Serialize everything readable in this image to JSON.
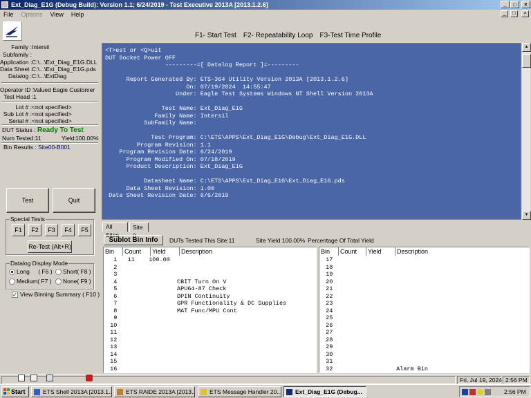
{
  "window": {
    "title": "Ext_Diag_E1G (Debug Build): Version 1.1;  6/24/2019 - Test Executive 2013A [2013.1.2.6]",
    "min_glyph": "_",
    "max_glyph": "□",
    "close_glyph": "×"
  },
  "menu": {
    "file": "File",
    "options": "Options",
    "view": "View",
    "help": "Help"
  },
  "toolbar": {
    "f1": "F1- Start Test",
    "f2": "F2- Repeatability Loop",
    "f3": "F3-Test Time Profile"
  },
  "info": {
    "family_lbl": "Family :",
    "family": "Intersil",
    "subfamily_lbl": "Subfamily :",
    "subfamily": "",
    "application_lbl": "Application :",
    "application": "C:\\...\\Ext_Diag_E1G.DLL",
    "datasheet_lbl": "Data Sheet :",
    "datasheet": "C:\\...\\Ext_Diag_E1G.pds",
    "datalog_lbl": "Datalog :",
    "datalog": "C:\\...\\ExtDiag",
    "operator_lbl": "Operator ID :",
    "operator": "Valued Eagle Customer",
    "testhead_lbl": "Test Head :",
    "testhead": "1",
    "lot_lbl": "Lot # :",
    "lot": "<not specified>",
    "sublot_lbl": "Sub Lot # :",
    "sublot": "<not specified>",
    "serial_lbl": "Serial # :",
    "serial": "<not specified>",
    "dutstatus_lbl": "DUT Status :",
    "dutstatus": "Ready To Test",
    "numtested_lbl": "Num Tested:",
    "numtested": "11",
    "yield_lbl": "Yield:",
    "yield": "100.00%",
    "binresults_lbl": "Bin Results :",
    "binresults": "Site00-B001"
  },
  "buttons": {
    "test": "Test",
    "quit": "Quit",
    "retest": "Re-Test  (Alt+R)"
  },
  "special_tests": {
    "title": "Special Tests",
    "keys": [
      "F1",
      "F2",
      "F3",
      "F4",
      "F5"
    ]
  },
  "datalog_mode": {
    "title": "Datalog Display Mode",
    "long": "Long",
    "long_key": "( F6 )",
    "short": "Short( F8 )",
    "medium": "Medium( F7 )",
    "none": "None( F9 )"
  },
  "view_binning": "View Binning Summary ( F10 )",
  "console": {
    "lines": [
      "<T>est or <Q>uit",
      "DUT Socket Power OFF",
      "                 ---------=[ Datalog Report ]=---------",
      "",
      "      Report Generated By: ETS-364 Utility Version 2013A [2013.1.2.6]",
      "                       On: 07/19/2024  14:55:47",
      "                    Under: Eagle Test Systems Windows NT Shell Version 2013A",
      "",
      "                Test Name: Ext_Diag_E1G",
      "              Family Name: Intersil",
      "           SubFamily Name:",
      "",
      "             Test Program: C:\\ETS\\APPS\\Ext_Diag_E1G\\Debug\\Ext_Diag_E1G.DLL",
      "         Program Revision: 1.1",
      "    Program Revision Date: 6/24/2019",
      "      Program Modified On: 07/18/2019",
      "      Product Description: Ext_Diag_E1G",
      "",
      "           Datasheet Name: C:\\ETS\\APPS\\Ext_Diag_E1G\\Ext_Diag_E1G.pds",
      "      Data Sheet Revision: 1.00",
      " Data Sheet Revision Date: 6/6/2019"
    ]
  },
  "tabs": [
    "All Sites",
    "Site 0"
  ],
  "bin_header": {
    "sublot": "Sublot Bin Info",
    "duts": "DUTs Tested This Site:11",
    "siteyield": "Site Yield 100.00%",
    "pct": "Percentage Of Total Yield"
  },
  "bin_columns": [
    "Bin",
    "Count",
    "Yield",
    "Description"
  ],
  "bins_left": [
    "  1   11    100.00",
    "  2",
    "  3",
    "  4                 CBIT Turn On V",
    "  5                 APU64-87 Check",
    "  6                 DPIN Continuity",
    "  7                 GPR Functionality & DC Supplies",
    "  8                 MAT Func/MPU Cont",
    "  9",
    " 10",
    " 11",
    " 12",
    " 13",
    " 14",
    " 15",
    " 16"
  ],
  "bins_right": [
    " 17",
    " 18",
    " 19",
    " 20",
    " 21",
    " 22",
    " 23",
    " 24",
    " 25",
    " 26",
    " 27",
    " 28",
    " 29",
    " 30",
    " 31",
    " 32                  Alarm Bin"
  ],
  "statusbar": {
    "date": "Fri, Jul 19, 2024",
    "time": "2:56 PM"
  },
  "taskbar": {
    "start": "Start",
    "tasks": [
      "ETS Shell 2013A [2013.1....",
      "ETS RAIDE 2013A [2013....",
      "ETS Message Handler 20...",
      "Ext_Diag_E1G (Debug..."
    ],
    "clock": "2:56 PM"
  },
  "colors": {
    "console_bg": "#4a66a7",
    "ready": "#008000",
    "bin_result": "#000080"
  }
}
